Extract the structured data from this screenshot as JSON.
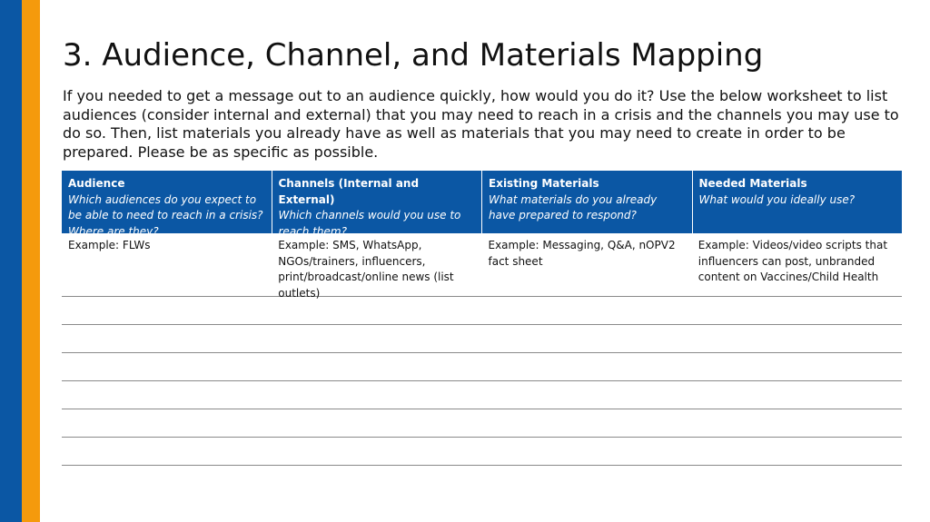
{
  "slide": {
    "title": "3. Audience, Channel, and Materials Mapping",
    "intro": "If you needed to get a message out to an audience quickly, how would you do it? Use the below worksheet to list audiences (consider internal and external) that you may need to reach in a crisis and the channels you may use to do so. Then, list materials you already have as well as materials that you may need to create in order to be prepared. Please be as specific as possible."
  },
  "table": {
    "headers": [
      {
        "title": "Audience",
        "subtitle": "Which audiences do you expect to be able to need to reach in a crisis? Where are they?"
      },
      {
        "title": "Channels (Internal and External)",
        "subtitle": "Which channels would you use to reach them?"
      },
      {
        "title": "Existing Materials",
        "subtitle": "What materials do you already have prepared to respond?"
      },
      {
        "title": "Needed Materials",
        "subtitle": "What would you ideally use?"
      }
    ],
    "example_row": [
      "Example:  FLWs",
      "Example: SMS, WhatsApp, NGOs/trainers, influencers, print/broadcast/online news (list outlets)",
      "Example: Messaging, Q&A, nOPV2 fact sheet",
      "Example: Videos/video scripts that influencers can post, unbranded content on Vaccines/Child Health"
    ],
    "empty_rows": 6
  },
  "colors": {
    "header_blue": "#0b57a4",
    "accent_orange": "#f59a0c",
    "rule_gray": "#8a8a8a"
  }
}
